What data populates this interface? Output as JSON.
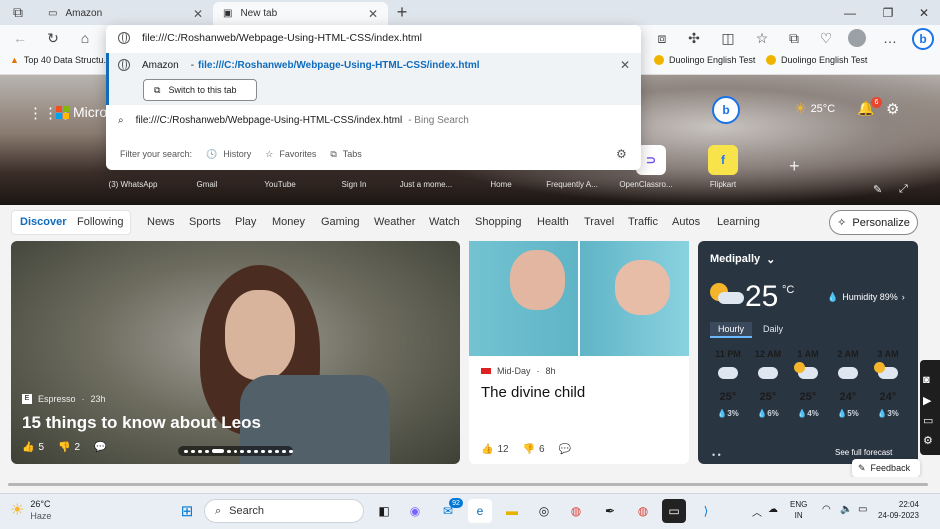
{
  "tabs": [
    {
      "title": "Amazon"
    },
    {
      "title": "New tab"
    }
  ],
  "address_bar": {
    "value": "file:///C:/Roshanweb/Webpage-Using-HTML-CSS/index.html"
  },
  "dropdown": {
    "suggestion_title": "Amazon",
    "suggestion_sep": "-",
    "suggestion_url": "file:///C:/Roshanweb/Webpage-Using-HTML-CSS/index.html",
    "switch_label": "Switch to this tab",
    "search_query": "file:///C:/Roshanweb/Webpage-Using-HTML-CSS/index.html",
    "search_suffix": "- Bing Search",
    "filter_label": "Filter your search:",
    "filters": [
      "History",
      "Favorites",
      "Tabs"
    ]
  },
  "favorites": {
    "left": "Top 40 Data Structu...",
    "right1": "Duolingo English Test",
    "right2": "Duolingo English Test"
  },
  "hero": {
    "brand": "Micro",
    "temp": "25°C",
    "notif_count": "6",
    "shortcuts": [
      "(3) WhatsApp",
      "Gmail",
      "YouTube",
      "Sign In",
      "Just a mome...",
      "Home",
      "Frequently A...",
      "OpenClassro...",
      "Flipkart"
    ]
  },
  "nav": {
    "items": [
      "Discover",
      "Following",
      "News",
      "Sports",
      "Play",
      "Money",
      "Gaming",
      "Weather",
      "Watch",
      "Shopping",
      "Health",
      "Travel",
      "Traffic",
      "Autos",
      "Learning"
    ],
    "personalize": "Personalize"
  },
  "card_main": {
    "source": "Espresso",
    "age": "23h",
    "title": "15 things to know about Leos",
    "likes": "5",
    "dislikes": "2"
  },
  "card_mid": {
    "source": "Mid-Day",
    "age": "8h",
    "title": "The divine child",
    "likes": "12",
    "dislikes": "6"
  },
  "weather": {
    "location": "Medipally",
    "temp": "25",
    "unit": "°C",
    "humidity": "Humidity 89%",
    "tabs": [
      "Hourly",
      "Daily"
    ],
    "hours": [
      {
        "time": "11 PM",
        "temp": "25°",
        "precip": "3%"
      },
      {
        "time": "12 AM",
        "temp": "25°",
        "precip": "6%"
      },
      {
        "time": "1 AM",
        "temp": "25°",
        "precip": "4%"
      },
      {
        "time": "2 AM",
        "temp": "24°",
        "precip": "5%"
      },
      {
        "time": "3 AM",
        "temp": "24°",
        "precip": "3%"
      }
    ],
    "forecast_link": "See full forecast"
  },
  "feedback": "Feedback",
  "taskbar": {
    "weather_temp": "26°C",
    "weather_desc": "Haze",
    "search": "Search",
    "mail_badge": "92",
    "lang": "ENG",
    "region": "IN",
    "time": "22:04",
    "date": "24-09-2023"
  }
}
